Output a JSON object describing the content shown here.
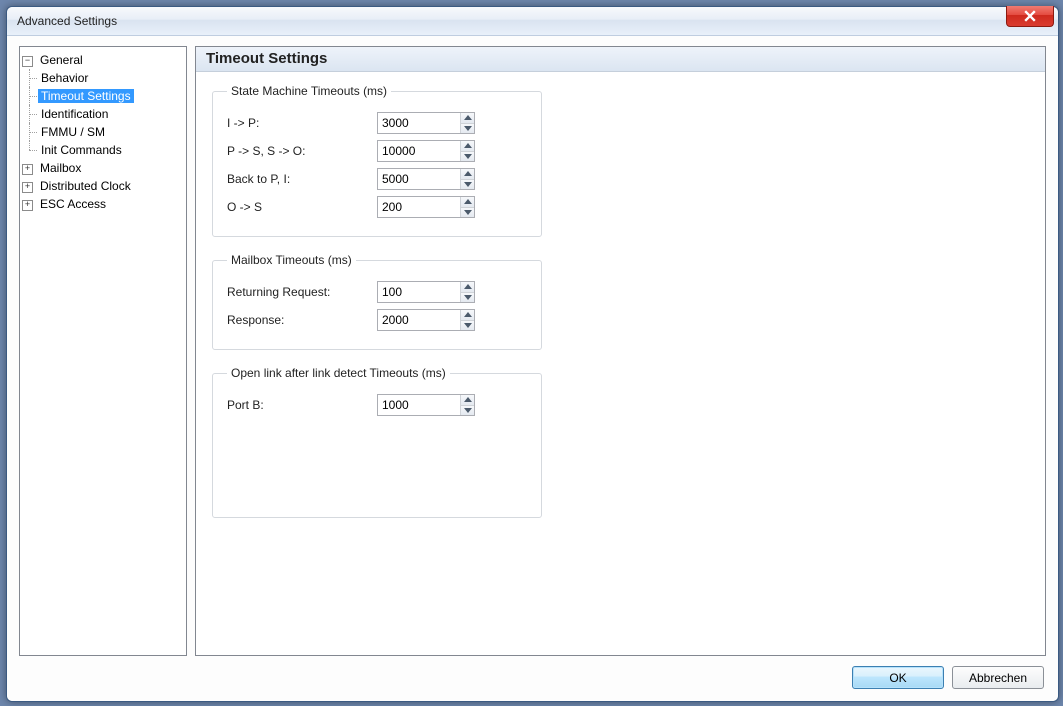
{
  "window": {
    "title": "Advanced Settings"
  },
  "tree": {
    "general": {
      "label": "General",
      "expanded": "−",
      "children": {
        "behavior": "Behavior",
        "timeout": "Timeout Settings",
        "identification": "Identification",
        "fmmu": "FMMU / SM",
        "init": "Init Commands"
      }
    },
    "mailbox": {
      "label": "Mailbox",
      "expanded": "+"
    },
    "dc": {
      "label": "Distributed Clock",
      "expanded": "+"
    },
    "esc": {
      "label": "ESC Access",
      "expanded": "+"
    }
  },
  "page": {
    "heading": "Timeout Settings",
    "group1": {
      "legend": "State Machine Timeouts (ms)",
      "ip": {
        "label": "I -> P:",
        "value": "3000"
      },
      "psso": {
        "label": "P -> S, S -> O:",
        "value": "10000"
      },
      "back": {
        "label": "Back to P, I:",
        "value": "5000"
      },
      "os": {
        "label": "O -> S",
        "value": "200"
      }
    },
    "group2": {
      "legend": "Mailbox Timeouts (ms)",
      "retreq": {
        "label": "Returning Request:",
        "value": "100"
      },
      "response": {
        "label": "Response:",
        "value": "2000"
      }
    },
    "group3": {
      "legend": "Open link after link detect Timeouts (ms)",
      "portb": {
        "label": "Port B:",
        "value": "1000"
      }
    }
  },
  "buttons": {
    "ok": "OK",
    "cancel": "Abbrechen"
  }
}
